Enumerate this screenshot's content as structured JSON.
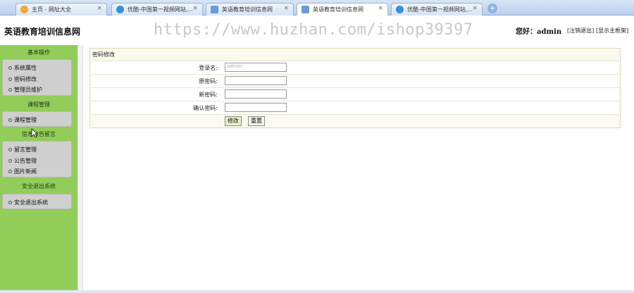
{
  "browser": {
    "tabs": [
      {
        "label": "主页 - 网址大全",
        "icon_color": "#f2a93b",
        "active": false
      },
      {
        "label": "优酷-中国第一视频网站,...",
        "icon_color": "#3a8fd6",
        "active": false
      },
      {
        "label": "英语教育培训信息网",
        "icon_color": "#6a9bd3",
        "active": false
      },
      {
        "label": "英语教育培训信息网",
        "icon_color": "#6a9bd3",
        "active": true
      },
      {
        "label": "优酷-中国第一视频网站,...",
        "icon_color": "#3a8fd6",
        "active": false
      }
    ],
    "close_glyph": "×",
    "new_tab_glyph": "+"
  },
  "header": {
    "site_title": "英语教育培训信息网",
    "watermark": "https://www.huzhan.com/ishop39397",
    "greeting": "您好：admin",
    "logout": "[注销退出]",
    "home": "[显示主框架]"
  },
  "sidebar": {
    "sections": [
      {
        "title": "基本操作",
        "items": [
          "系统属性",
          "密码修改",
          "管理员维护"
        ]
      },
      {
        "title": "课程管理",
        "items": [
          "课程管理"
        ]
      },
      {
        "title": "信息公告留言",
        "items": [
          "留言管理",
          "公告管理",
          "图片新闻"
        ]
      },
      {
        "title": "安全退出系统",
        "items": [
          "安全退出系统"
        ]
      }
    ]
  },
  "form": {
    "title": "密码修改",
    "username_label": "登录名:",
    "username_value": "admin",
    "old_password_label": "原密码:",
    "new_password_label": "新密码:",
    "confirm_password_label": "确认密码:",
    "submit": "修改",
    "reset": "重置"
  },
  "colors": {
    "sidebar_bg": "#92cc59",
    "menu_box_bg": "#cfcfcf",
    "panel_bg": "#f9f9ec"
  }
}
